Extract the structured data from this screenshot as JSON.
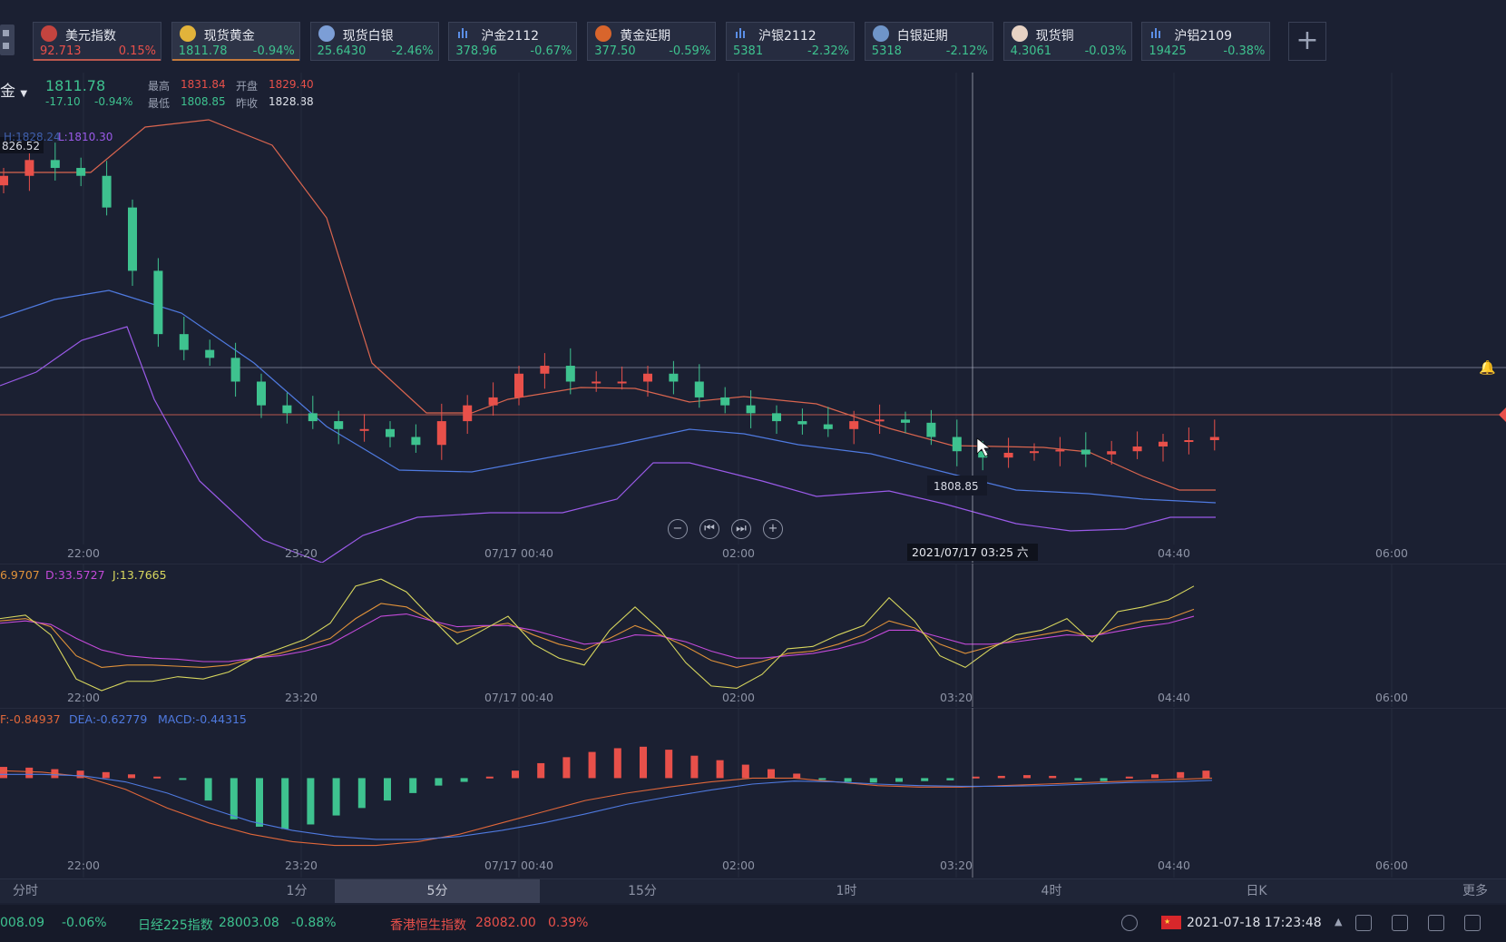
{
  "tickers": [
    {
      "name": "美元指数",
      "price": "92.713",
      "change": "0.15%",
      "dir": "up",
      "icon": "us-flag-icon"
    },
    {
      "name": "现货黄金",
      "price": "1811.78",
      "change": "-0.94%",
      "dir": "dn",
      "icon": "gold-coin-icon"
    },
    {
      "name": "现货白银",
      "price": "25.6430",
      "change": "-2.46%",
      "dir": "dn",
      "icon": "silver-coin-icon"
    },
    {
      "name": "沪金2112",
      "price": "378.96",
      "change": "-0.67%",
      "dir": "dn",
      "icon": "bar-chart-icon"
    },
    {
      "name": "黄金延期",
      "price": "377.50",
      "change": "-0.59%",
      "dir": "dn",
      "icon": "gold-bars-icon"
    },
    {
      "name": "沪银2112",
      "price": "5381",
      "change": "-2.32%",
      "dir": "dn",
      "icon": "bar-chart-icon"
    },
    {
      "name": "白银延期",
      "price": "5318",
      "change": "-2.12%",
      "dir": "dn",
      "icon": "silver-bars-icon"
    },
    {
      "name": "现货铜",
      "price": "4.3061",
      "change": "-0.03%",
      "dir": "dn",
      "icon": "copper-icon"
    },
    {
      "name": "沪铝2109",
      "price": "19425",
      "change": "-0.38%",
      "dir": "dn",
      "icon": "bar-chart-icon"
    }
  ],
  "header": {
    "symbol": "金",
    "price": "1811.78",
    "change": "-17.10",
    "change_pct": "-0.94%",
    "high_label": "最高",
    "high": "1831.84",
    "open_label": "开盘",
    "open": "1829.40",
    "low_label": "最低",
    "low": "1808.85",
    "prev_label": "昨收",
    "prev": "1828.88"
  },
  "boll": {
    "text": "H:1828.24",
    "lower": "L:1810.30",
    "tag": "826.52"
  },
  "crosshair": {
    "time": "2021/07/17 03:25 六",
    "low_tag": "1808.85"
  },
  "xaxis": [
    "22:00",
    "23:20",
    "07/17 00:40",
    "02:00",
    "03:20",
    "04:40",
    "06:00"
  ],
  "kdj": {
    "k": "6.9707",
    "d": "D:33.5727",
    "j": "J:13.7665"
  },
  "macd": {
    "dif": "F:-0.84937",
    "dea": "DEA:-0.62779",
    "macd": "MACD:-0.44315"
  },
  "timeframes": [
    "分时",
    "1分",
    "5分",
    "15分",
    "1时",
    "4时",
    "日K",
    "更多"
  ],
  "selected_timeframe": "5分",
  "status": {
    "idx1_val": "008.09",
    "idx1_pct": "-0.06%",
    "idx2_name": "日经225指数",
    "idx2_val": "28003.08",
    "idx2_pct": "-0.88%",
    "idx3_name": "香港恒生指数",
    "idx3_val": "28082.00",
    "idx3_pct": "0.39%",
    "datetime": "2021-07-18 17:23:48"
  },
  "chart_data": {
    "type": "candlestick",
    "title": "现货黄金 5分",
    "ylim": [
      1807,
      1832
    ],
    "candles_close_approx": [
      1828,
      1829,
      1828.5,
      1828,
      1826,
      1822,
      1818,
      1817,
      1816.5,
      1815,
      1813.5,
      1813,
      1812.5,
      1812,
      1812,
      1811.5,
      1811,
      1812.5,
      1813.5,
      1814,
      1815.5,
      1816,
      1815,
      1815,
      1815,
      1815.5,
      1815,
      1814,
      1813.5,
      1813,
      1812.5,
      1812.3,
      1812,
      1812.5,
      1812.6,
      1812.4,
      1811.5,
      1810.6,
      1810.2,
      1810.5,
      1810.6,
      1810.7,
      1810.4,
      1810.6,
      1810.9,
      1811.2,
      1811.3,
      1811.5
    ],
    "kdj_range": [
      0,
      100
    ],
    "macd_range": [
      -1.1,
      0.6
    ]
  }
}
